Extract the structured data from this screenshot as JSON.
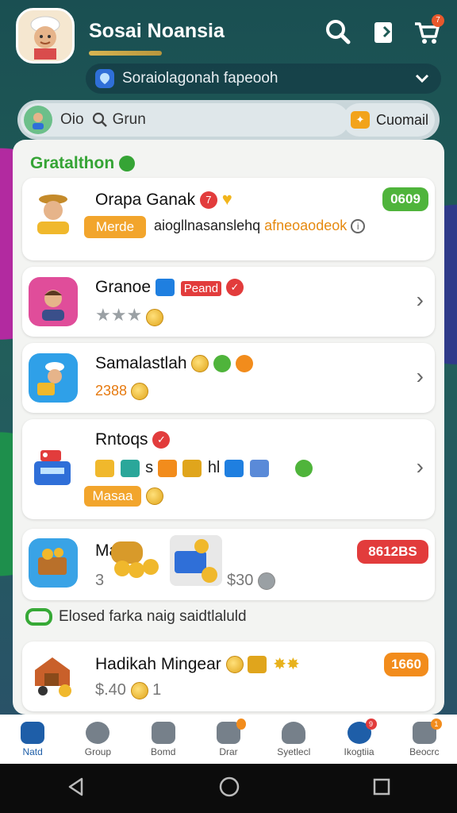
{
  "header": {
    "title": "Sosai Noansia",
    "location": "Soraiolagonah fapeooh",
    "cart_count": "7"
  },
  "search": {
    "prefix": "Oio",
    "text": "Grun",
    "command_label": "Cuomail"
  },
  "section_title": "Gratalthon",
  "cards": [
    {
      "name": "Orapa Ganak",
      "badge": "0609",
      "tag": "Merde",
      "subtitle": "aiogllnasanslehq",
      "subtitle_highlight": "afneoaodeok"
    },
    {
      "name": "Granoe",
      "label": "Peand",
      "rating": 3
    },
    {
      "name": "Samalastlah",
      "price": "2388"
    },
    {
      "name": "Rntoqs",
      "row_text": "s",
      "row_text2": "hl",
      "tag": "Masaa"
    },
    {
      "name": "Ma",
      "badge": "8612BS",
      "price_prefix": "3",
      "price": "$30"
    },
    {
      "name": "Hadikah Mingear",
      "badge": "1660",
      "price": "$.40",
      "count": "1"
    }
  ],
  "closed_label": "Elosed farka naig saidtlaluld",
  "nav": [
    {
      "label": "Natd",
      "icon": "home-icon",
      "active": true
    },
    {
      "label": "Group",
      "icon": "group-icon"
    },
    {
      "label": "Bomd",
      "icon": "music-icon"
    },
    {
      "label": "Drar",
      "icon": "heart-icon",
      "badge": ""
    },
    {
      "label": "Syetlecl",
      "icon": "person-icon"
    },
    {
      "label": "Ikogtiia",
      "icon": "notification-icon",
      "badge": "9"
    },
    {
      "label": "Beocrc",
      "icon": "bag-icon",
      "badge": "1"
    }
  ],
  "colors": {
    "accent_green": "#35a435",
    "badge_green": "#4fb43b",
    "badge_red": "#e23c3c",
    "badge_orange": "#f28c1c",
    "nav_active": "#1e5ea8"
  }
}
